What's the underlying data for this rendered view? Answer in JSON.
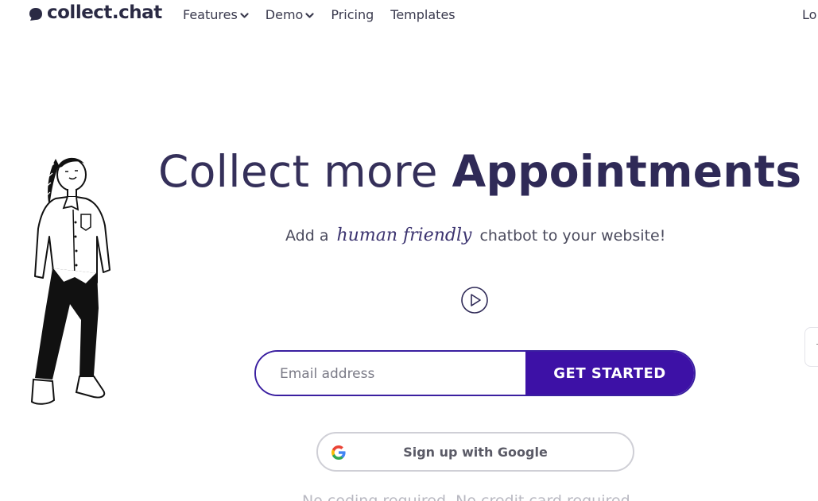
{
  "header": {
    "logo_text": "collect.chat",
    "nav": [
      {
        "label": "Features",
        "has_dropdown": true
      },
      {
        "label": "Demo",
        "has_dropdown": true
      },
      {
        "label": "Pricing",
        "has_dropdown": false
      },
      {
        "label": "Templates",
        "has_dropdown": false
      }
    ],
    "login_label": "Lo"
  },
  "hero": {
    "title_light": "Collect more ",
    "title_bold": "Appointments",
    "subtitle_prefix": "Add a",
    "subtitle_script": "human friendly",
    "subtitle_suffix": "chatbot to your website!"
  },
  "signup": {
    "email_placeholder": "Email address",
    "email_value": "",
    "button_label": "GET STARTED"
  },
  "google": {
    "label": "Sign up with Google"
  },
  "footnote": "No coding required. No credit card required",
  "colors": {
    "brand_dark": "#2f2a57",
    "button_purple": "#3d11a6",
    "form_border": "#3a1fa0",
    "google_border": "#cfcfd6"
  },
  "icons": [
    "chat-bubble-icon",
    "chevron-down-icon",
    "play-icon",
    "google-icon"
  ]
}
